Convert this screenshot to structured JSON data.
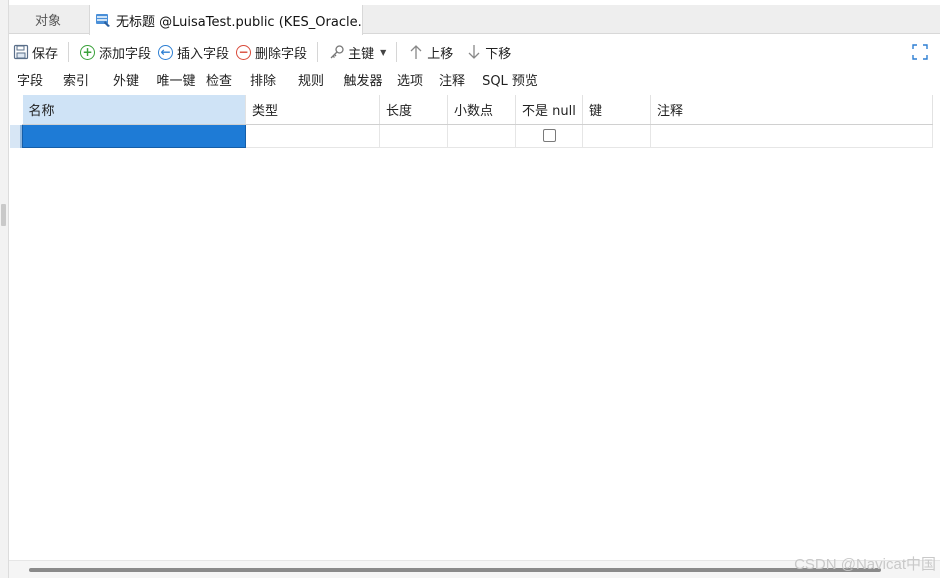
{
  "tabs": [
    {
      "label": "对象"
    },
    {
      "label": "无标题 @LuisaTest.public (KES_Oracle..."
    }
  ],
  "toolbar": {
    "save": "保存",
    "add_field": "添加字段",
    "insert_field": "插入字段",
    "delete_field": "删除字段",
    "primary_key": "主键",
    "move_up": "上移",
    "move_down": "下移"
  },
  "subtabs": [
    "字段",
    "索引",
    "外键",
    "唯一键",
    "检查",
    "排除",
    "规则",
    "触发器",
    "选项",
    "注释",
    "SQL 预览"
  ],
  "table": {
    "columns": [
      "名称",
      "类型",
      "长度",
      "小数点",
      "不是 null",
      "键",
      "注释"
    ],
    "rows": [
      {
        "name": "",
        "type": "",
        "length": "",
        "decimals": "",
        "not_null": false,
        "key": "",
        "comment": ""
      }
    ]
  },
  "watermark": "CSDN @Navicat中国",
  "colors": {
    "accent": "#1e7bd6",
    "header_selected": "#cfe3f6"
  }
}
